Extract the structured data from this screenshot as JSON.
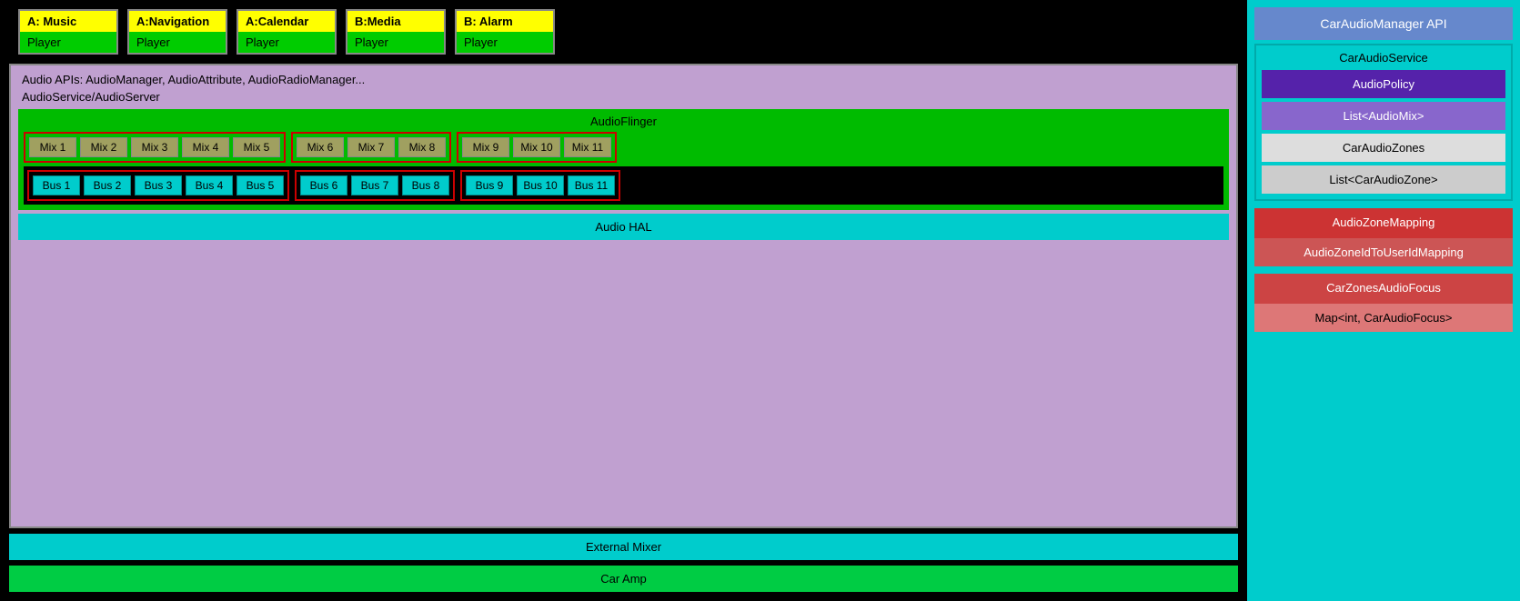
{
  "players": [
    {
      "id": "a-music",
      "top": "A: Music",
      "bottom": "Player"
    },
    {
      "id": "a-navigation",
      "top": "A:Navigation",
      "bottom": "Player"
    },
    {
      "id": "a-calendar",
      "top": "A:Calendar",
      "bottom": "Player"
    },
    {
      "id": "b-media",
      "top": "B:Media",
      "bottom": "Player"
    },
    {
      "id": "b-alarm",
      "top": "B: Alarm",
      "bottom": "Player"
    }
  ],
  "audio_apis_label": "Audio APIs: AudioManager, AudioAttribute, AudioRadioManager...",
  "audio_service_label": "AudioService/AudioServer",
  "audio_flinger_label": "AudioFlinger",
  "zones": [
    {
      "id": "zone1",
      "mixes": [
        "Mix 1",
        "Mix 2",
        "Mix 3",
        "Mix 4",
        "Mix 5"
      ],
      "buses": [
        "Bus 1",
        "Bus 2",
        "Bus 3",
        "Bus 4",
        "Bus 5"
      ]
    },
    {
      "id": "zone2",
      "mixes": [
        "Mix 6",
        "Mix 7",
        "Mix 8"
      ],
      "buses": [
        "Bus 6",
        "Bus 7",
        "Bus 8"
      ]
    },
    {
      "id": "zone3",
      "mixes": [
        "Mix 9",
        "Mix 10",
        "Mix 11"
      ],
      "buses": [
        "Bus 9",
        "Bus 10",
        "Bus 11"
      ]
    }
  ],
  "audio_hal_label": "Audio HAL",
  "external_mixer_label": "External Mixer",
  "car_amp_label": "Car Amp",
  "right_panel": {
    "car_audio_manager_api": "CarAudioManager API",
    "car_audio_service_label": "CarAudioService",
    "audio_policy": "AudioPolicy",
    "list_audio_mix": "List<AudioMix>",
    "car_audio_zones": "CarAudioZones",
    "list_car_audio_zone": "List<CarAudioZone>",
    "audio_zone_mapping": "AudioZoneMapping",
    "audio_zone_id_to_user_id": "AudioZoneIdToUserIdMapping",
    "car_zones_audio_focus": "CarZonesAudioFocus",
    "map_int_car_audio_focus": "Map<int, CarAudioFocus>"
  }
}
